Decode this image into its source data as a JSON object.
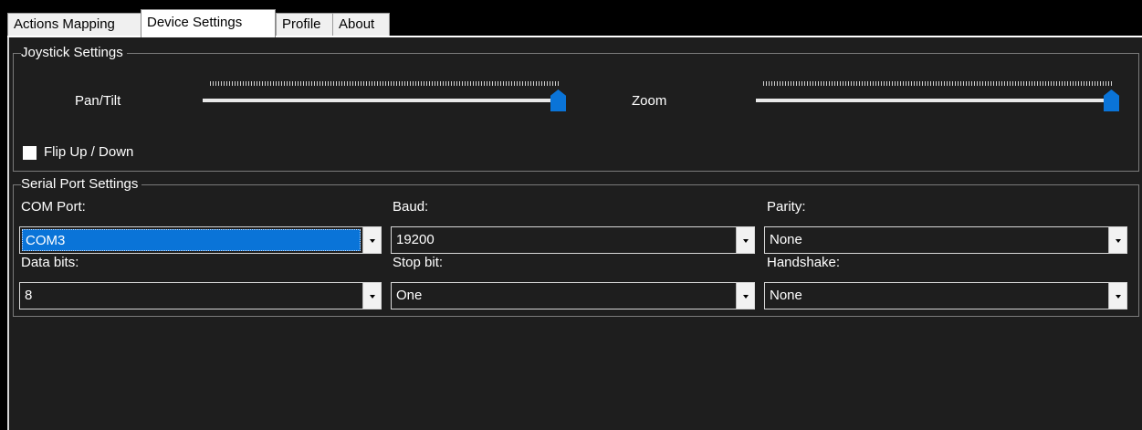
{
  "tabs": [
    {
      "label": "Actions Mapping"
    },
    {
      "label": "Device Settings"
    },
    {
      "label": "Profile"
    },
    {
      "label": "About"
    }
  ],
  "active_tab": "Device Settings",
  "joystick": {
    "legend": "Joystick Settings",
    "pan_tilt_label": "Pan/Tilt",
    "pan_tilt_value": 1.0,
    "zoom_label": "Zoom",
    "zoom_value": 1.0,
    "flip_label": "Flip Up / Down",
    "flip_checked": false
  },
  "serial": {
    "legend": "Serial Port Settings",
    "com_port": {
      "label": "COM Port:",
      "value": "COM3"
    },
    "baud": {
      "label": "Baud:",
      "value": "19200"
    },
    "parity": {
      "label": "Parity:",
      "value": "None"
    },
    "data_bits": {
      "label": "Data bits:",
      "value": "8"
    },
    "stop_bit": {
      "label": "Stop bit:",
      "value": "One"
    },
    "handshake": {
      "label": "Handshake:",
      "value": "None"
    }
  },
  "colors": {
    "accent": "#0a74d8",
    "panel_bg": "#1e1e1e"
  }
}
